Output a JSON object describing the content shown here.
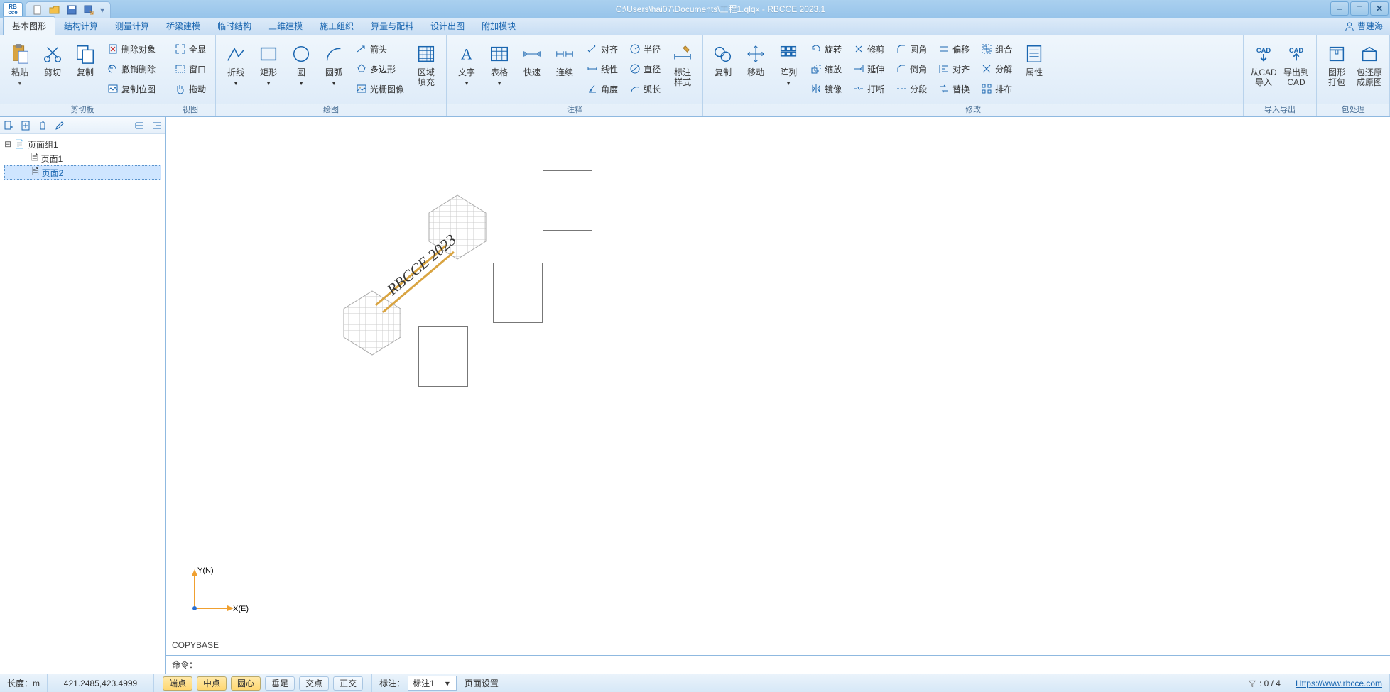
{
  "window": {
    "title": "C:\\Users\\hai07\\Documents\\工程1.qlqx - RBCCE 2023.1",
    "app_logo_top": "RB",
    "app_logo_bot": "cce"
  },
  "user": {
    "name": "曹建海"
  },
  "tabs": {
    "t0": "基本图形",
    "t1": "结构计算",
    "t2": "测量计算",
    "t3": "桥梁建模",
    "t4": "临时结构",
    "t5": "三维建模",
    "t6": "施工组织",
    "t7": "算量与配料",
    "t8": "设计出图",
    "t9": "附加模块"
  },
  "ribbon": {
    "g_clip": {
      "label": "剪切板",
      "paste": "粘贴",
      "cut": "剪切",
      "copy": "复制",
      "del": "删除对象",
      "undo": "撤销删除",
      "copypos": "复制位图"
    },
    "g_view": {
      "label": "视图",
      "full": "全显",
      "window": "窗口",
      "drag": "拖动"
    },
    "g_draw": {
      "label": "绘图",
      "poly": "折线",
      "rect": "矩形",
      "circle": "圆",
      "arc": "圆弧",
      "arrow": "箭头",
      "polygon": "多边形",
      "raster": "光栅图像",
      "fill": "区域\n填充"
    },
    "g_ann": {
      "label": "注释",
      "text": "文字",
      "table": "表格",
      "quick": "快速",
      "cont": "连续",
      "align": "对齐",
      "radius": "半径",
      "linear": "线性",
      "dia": "直径",
      "angle": "角度",
      "arclen": "弧长",
      "dimstyle": "标注\n样式"
    },
    "g_mod": {
      "label": "修改",
      "copy": "复制",
      "move": "移动",
      "array": "阵列",
      "rotate": "旋转",
      "scale": "缩放",
      "mirror": "镜像",
      "trim": "修剪",
      "extend": "延伸",
      "break": "打断",
      "fillet": "圆角",
      "chamfer": "倒角",
      "segment": "分段",
      "offset": "偏移",
      "align2": "对齐",
      "replace": "替换",
      "group": "组合",
      "explode": "分解",
      "sort": "排布",
      "props": "属性"
    },
    "g_io": {
      "label": "导入导出",
      "fromcad": "从CAD\n导入",
      "tocad": "导出到\nCAD"
    },
    "g_pkg": {
      "label": "包处理",
      "pack": "图形\n打包",
      "restore": "包还原\n成原图"
    }
  },
  "tree": {
    "root": "页面组1",
    "p1": "页面1",
    "p2": "页面2"
  },
  "canvas": {
    "rot_text": "RBCCE 2023",
    "axis_x": "X(E)",
    "axis_y": "Y(N)"
  },
  "cmd": {
    "log": "COPYBASE",
    "prompt": "命令："
  },
  "status": {
    "len_lbl": "长度：",
    "len_unit": "m",
    "coords": "421.2485,423.4999",
    "snap_end": "端点",
    "snap_mid": "中点",
    "snap_cen": "圆心",
    "snap_perp": "垂足",
    "snap_int": "交点",
    "snap_ortho": "正交",
    "dim_lbl": "标注：",
    "dim_val": "标注1",
    "page_set": "页面设置",
    "sel": ": 0 / 4",
    "url": "Https://www.rbcce.com"
  }
}
